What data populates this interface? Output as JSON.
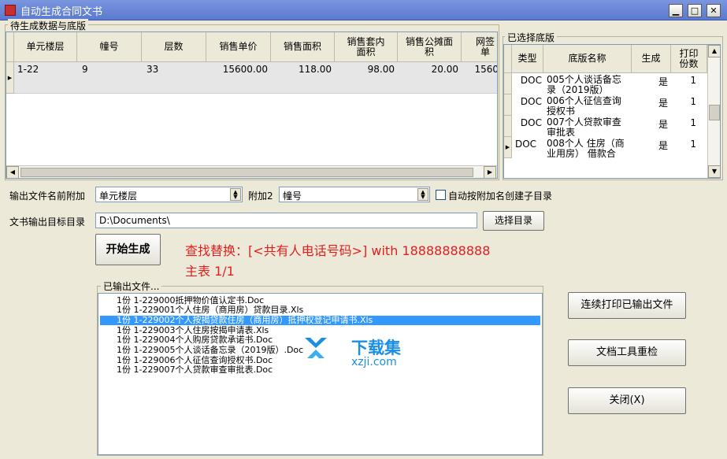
{
  "window": {
    "title": "自动生成合同文书",
    "btn_min": "▁",
    "btn_max": "□",
    "btn_close": "✕"
  },
  "pending": {
    "group_title": "待生成数据与底版",
    "columns": [
      "单元楼层",
      "幢号",
      "层数",
      "销售单价",
      "销售面积",
      "销售套内面积",
      "销售公摊面积",
      "网签单"
    ],
    "rows": [
      [
        "1-22",
        "9",
        "33",
        "15600.00",
        "118.00",
        "98.00",
        "20.00",
        "1560"
      ]
    ]
  },
  "selected": {
    "group_title": "已选择底版",
    "columns": [
      "类型",
      "底版名称",
      "生成",
      "打印份数"
    ],
    "rows": [
      {
        "type": "DOC",
        "name": "005个人谈话备忘录（2019版）",
        "gen": "是",
        "copies": "1"
      },
      {
        "type": "DOC",
        "name": "006个人征信查询授权书",
        "gen": "是",
        "copies": "1"
      },
      {
        "type": "DOC",
        "name": "007个人贷款审查审批表",
        "gen": "是",
        "copies": "1"
      },
      {
        "type": "DOC",
        "name": "008个人 住房（商业用房） 借款合",
        "gen": "是",
        "copies": "1"
      }
    ]
  },
  "prefix": {
    "label": "输出文件名前附加",
    "value": "单元楼层",
    "label2": "附加2",
    "value2": "幢号",
    "auto_label": "自动按附加名创建子目录"
  },
  "outdir": {
    "label": "文书输出目标目录",
    "value": "D:\\Documents\\",
    "browse": "选择目录"
  },
  "start_button": "开始生成",
  "status": {
    "line1": "查找替换：[<共有人电话号码>] with 18888888888",
    "line2": "主表 1/1"
  },
  "output": {
    "group_title": "已输出文件...",
    "files": [
      "1份 1-229000抵押物价值认定书.Doc",
      "1份 1-229001个人住房（商用房）贷款目录.Xls",
      "1份 1-229002个人按揭贷款住房（商用房）抵押权登记申请书.Xls",
      "1份 1-229003个人住房按揭申请表.Xls",
      "1份 1-229004个人购房贷款承诺书.Doc",
      "1份 1-229005个人谈话备忘录（2019版）.Doc",
      "1份 1-229006个人征信查询授权书.Doc",
      "1份 1-229007个人贷款审查审批表.Doc"
    ],
    "selected_index": 2
  },
  "buttons": {
    "print_all": "连续打印已输出文件",
    "recheck": "文档工具重检",
    "close": "关闭(X)"
  },
  "watermark": {
    "brand": "下载集",
    "url": "xzji.com"
  }
}
